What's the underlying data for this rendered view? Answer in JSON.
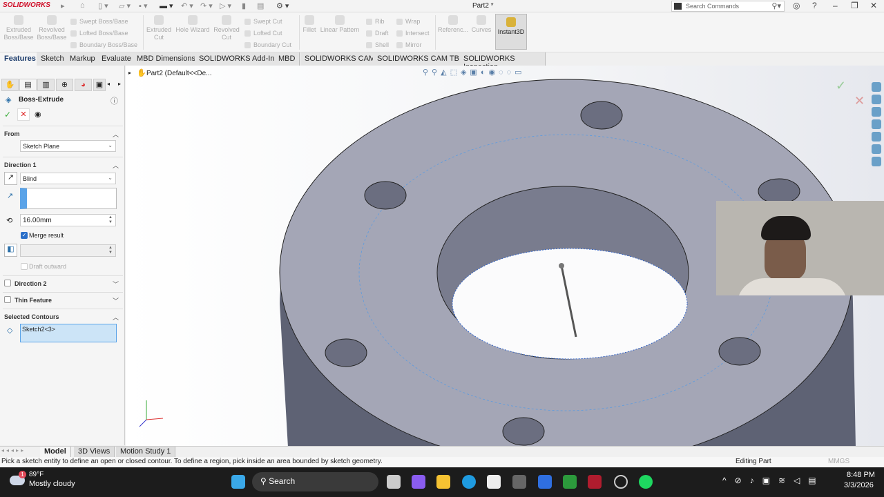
{
  "titlebar": {
    "app": "SOLIDWORKS",
    "document": "Part2 *",
    "search_placeholder": "Search Commands"
  },
  "command_manager": {
    "buttons": [
      "Extruded Boss/Base",
      "Revolved Boss/Base",
      "Extruded Cut",
      "Hole Wizard",
      "Revolved Cut",
      "Fillet",
      "Linear Pattern",
      "Referenc...",
      "Curves",
      "Instant3D"
    ],
    "small": [
      "Swept Boss/Base",
      "Lofted Boss/Base",
      "Boundary Boss/Base",
      "Swept Cut",
      "Lofted Cut",
      "Boundary Cut",
      "Rib",
      "Draft",
      "Shell",
      "Wrap",
      "Intersect",
      "Mirror"
    ]
  },
  "tabs": [
    "Features",
    "Sketch",
    "Markup",
    "Evaluate",
    "MBD Dimensions",
    "SOLIDWORKS Add-Ins",
    "MBD",
    "SOLIDWORKS CAM",
    "SOLIDWORKS CAM TBM",
    "SOLIDWORKS Inspection"
  ],
  "property_manager": {
    "title": "Boss-Extrude",
    "from": {
      "label": "From",
      "value": "Sketch Plane"
    },
    "direction1": {
      "label": "Direction 1",
      "end_condition": "Blind",
      "depth": "16.00mm",
      "merge_result": "Merge result",
      "merge_checked": true,
      "draft_outward": "Draft outward"
    },
    "direction2": "Direction 2",
    "thin_feature": "Thin Feature",
    "selected_contours": {
      "label": "Selected Contours",
      "value": "Sketch2<3>"
    }
  },
  "tree": {
    "item": "Part2  (Default<<De..."
  },
  "bottom_tabs": [
    "Model",
    "3D Views",
    "Motion Study 1"
  ],
  "status": {
    "message": "Pick a sketch entity to define an open or closed contour. To define a region, pick inside an area bounded by sketch geometry.",
    "mode": "Editing Part",
    "units": "MMGS"
  },
  "taskbar": {
    "weather_temp": "89°F",
    "weather_desc": "Mostly cloudy",
    "weather_badge": "1",
    "search": "Search",
    "time": "8:48 PM",
    "date": "3/3/2026"
  }
}
